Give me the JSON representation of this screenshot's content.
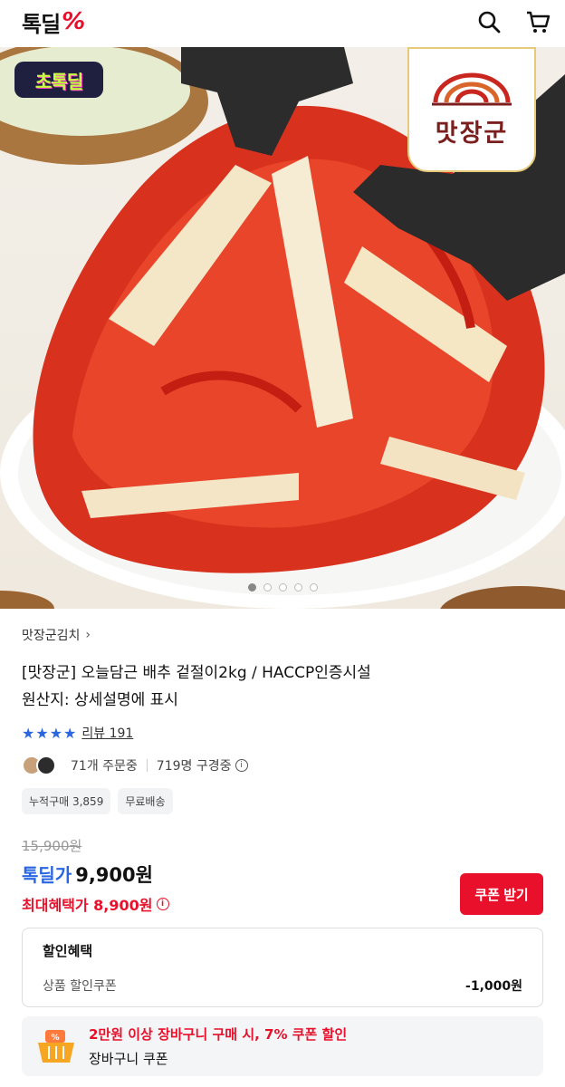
{
  "header": {
    "logo_text": "톡딜",
    "logo_mark": "%",
    "icons": [
      "search-icon",
      "cart-icon"
    ]
  },
  "hero": {
    "badge": "초톡딜",
    "brand_card": "맛장군",
    "slide_count": 5,
    "active_slide": 1
  },
  "product": {
    "store_link": "맛장군김치",
    "title_line1": "[맛장군] 오늘담근 배추 겉절이2kg / HACCP인증시설",
    "title_line2": "원산지: 상세설명에 표시",
    "rating_stars": 4,
    "review_label": "리뷰 191",
    "orders": "71개 주문중",
    "viewers": "719명 구경중",
    "chips": [
      "누적구매 3,859",
      "무료배송"
    ],
    "original_price": "15,900원",
    "deal_label": "톡딜가",
    "deal_price": "9,900원",
    "max_benefit": "최대혜택가 8,900원",
    "coupon_button": "쿠폰 받기"
  },
  "discount": {
    "title": "할인혜택",
    "label": "상품 할인쿠폰",
    "amount": "-1,000원"
  },
  "cart_banner": {
    "line1": "2만원 이상 장바구니 구매 시, 7% 쿠폰 할인",
    "line2": "장바구니 쿠폰"
  },
  "colors": {
    "brand_red": "#e8102a",
    "brand_blue": "#2a66e0"
  }
}
